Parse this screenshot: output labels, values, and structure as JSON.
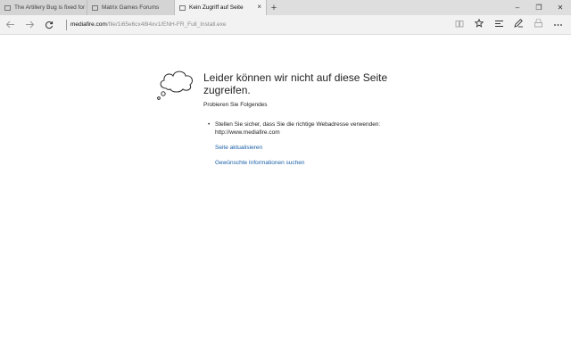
{
  "tabs": [
    {
      "label": "The Artillery Bug is fixed for",
      "active": false
    },
    {
      "label": "Matrix Games Forums",
      "active": false
    },
    {
      "label": "Kein Zugriff auf Seite",
      "active": true
    }
  ],
  "tab_close_glyph": "×",
  "new_tab_glyph": "+",
  "window_controls": {
    "minimize": "–",
    "restore": "❐",
    "close": "✕"
  },
  "address": {
    "domain": "mediafire.com",
    "path": "/file/1i65e6cx48l4xv1/ENH-FR_Full_Install.exe"
  },
  "error_page": {
    "heading": "Leider können wir nicht auf diese Seite zugreifen.",
    "try_text": "Probieren Sie Folgendes",
    "bullet_line1": "Stellen Sie sicher, dass Sie die richtige Webadresse verwenden:",
    "bullet_line2": "http://www.mediafire.com",
    "link_refresh": "Seite aktualisieren",
    "link_search": "Gewünschte Informationen suchen"
  },
  "icons": {
    "back": "arrow-left-icon",
    "forward": "arrow-right-icon",
    "refresh": "refresh-icon",
    "reading_view": "book-icon",
    "favorite": "star-icon",
    "hub": "hub-icon",
    "note": "pen-icon",
    "share": "share-icon",
    "more": "more-icon"
  }
}
